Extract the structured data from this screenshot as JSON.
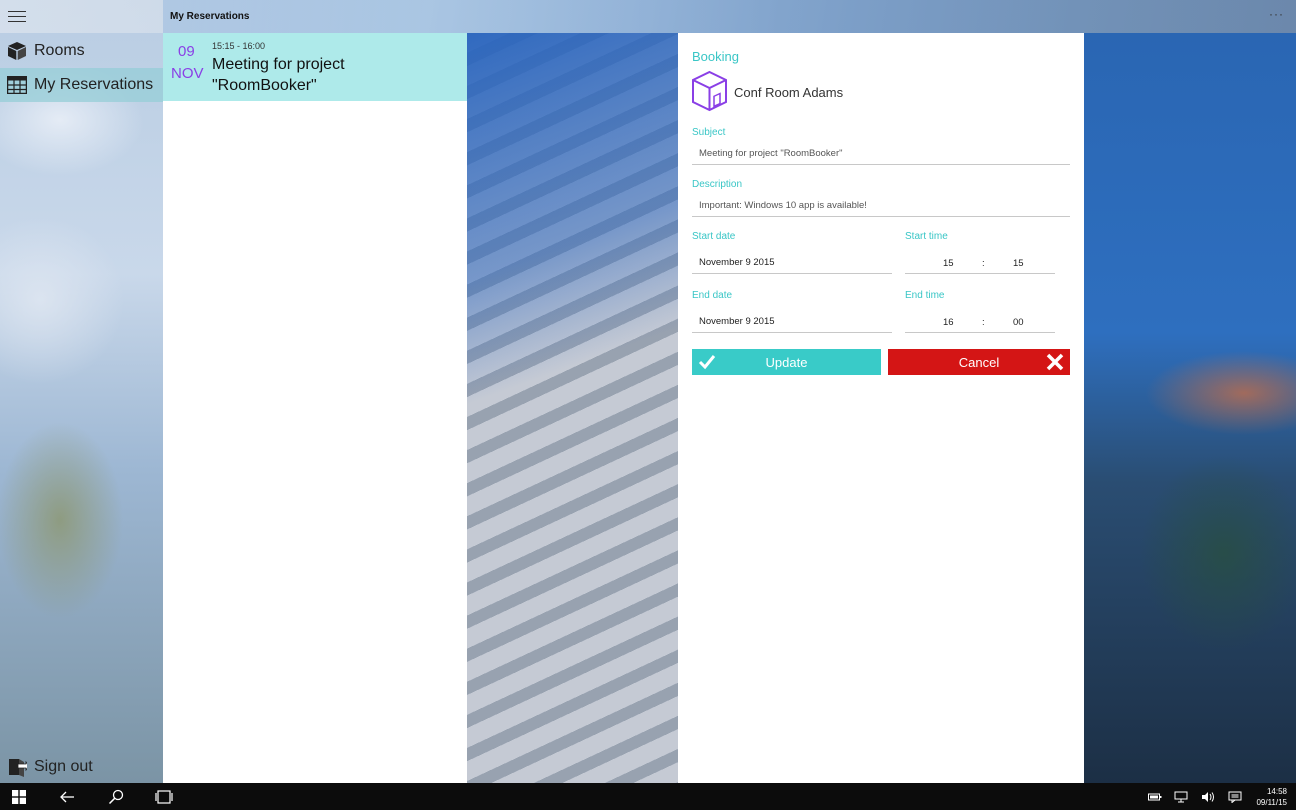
{
  "window": {
    "title": "My Reservations"
  },
  "nav": {
    "items": [
      {
        "label": "Rooms",
        "icon": "cube-icon"
      },
      {
        "label": "My Reservations",
        "icon": "calendar-grid-icon"
      }
    ],
    "sign_out": {
      "label": "Sign out",
      "icon": "sign-out-icon"
    }
  },
  "reservations": [
    {
      "day": "09",
      "month": "NOV",
      "time": "15:15 - 16:00",
      "title": "Meeting for project \"RoomBooker\""
    }
  ],
  "booking": {
    "heading": "Booking",
    "room_name": "Conf Room Adams",
    "subject": {
      "label": "Subject",
      "value": "Meeting for project \"RoomBooker\""
    },
    "description": {
      "label": "Description",
      "value": "Important: Windows 10 app is available!"
    },
    "start_date": {
      "label": "Start date",
      "value": "November 9 2015"
    },
    "start_time": {
      "label": "Start time",
      "hour": "15",
      "sep": ":",
      "minute": "15"
    },
    "end_date": {
      "label": "End date",
      "value": "November 9 2015"
    },
    "end_time": {
      "label": "End time",
      "hour": "16",
      "sep": ":",
      "minute": "00"
    },
    "update_label": "Update",
    "cancel_label": "Cancel"
  },
  "taskbar": {
    "time": "14:58",
    "date": "09/11/15"
  },
  "colors": {
    "accent": "#39cbc8",
    "cancel": "#d41515",
    "purple": "#8a3fe6",
    "selected": "#aeeaea"
  }
}
